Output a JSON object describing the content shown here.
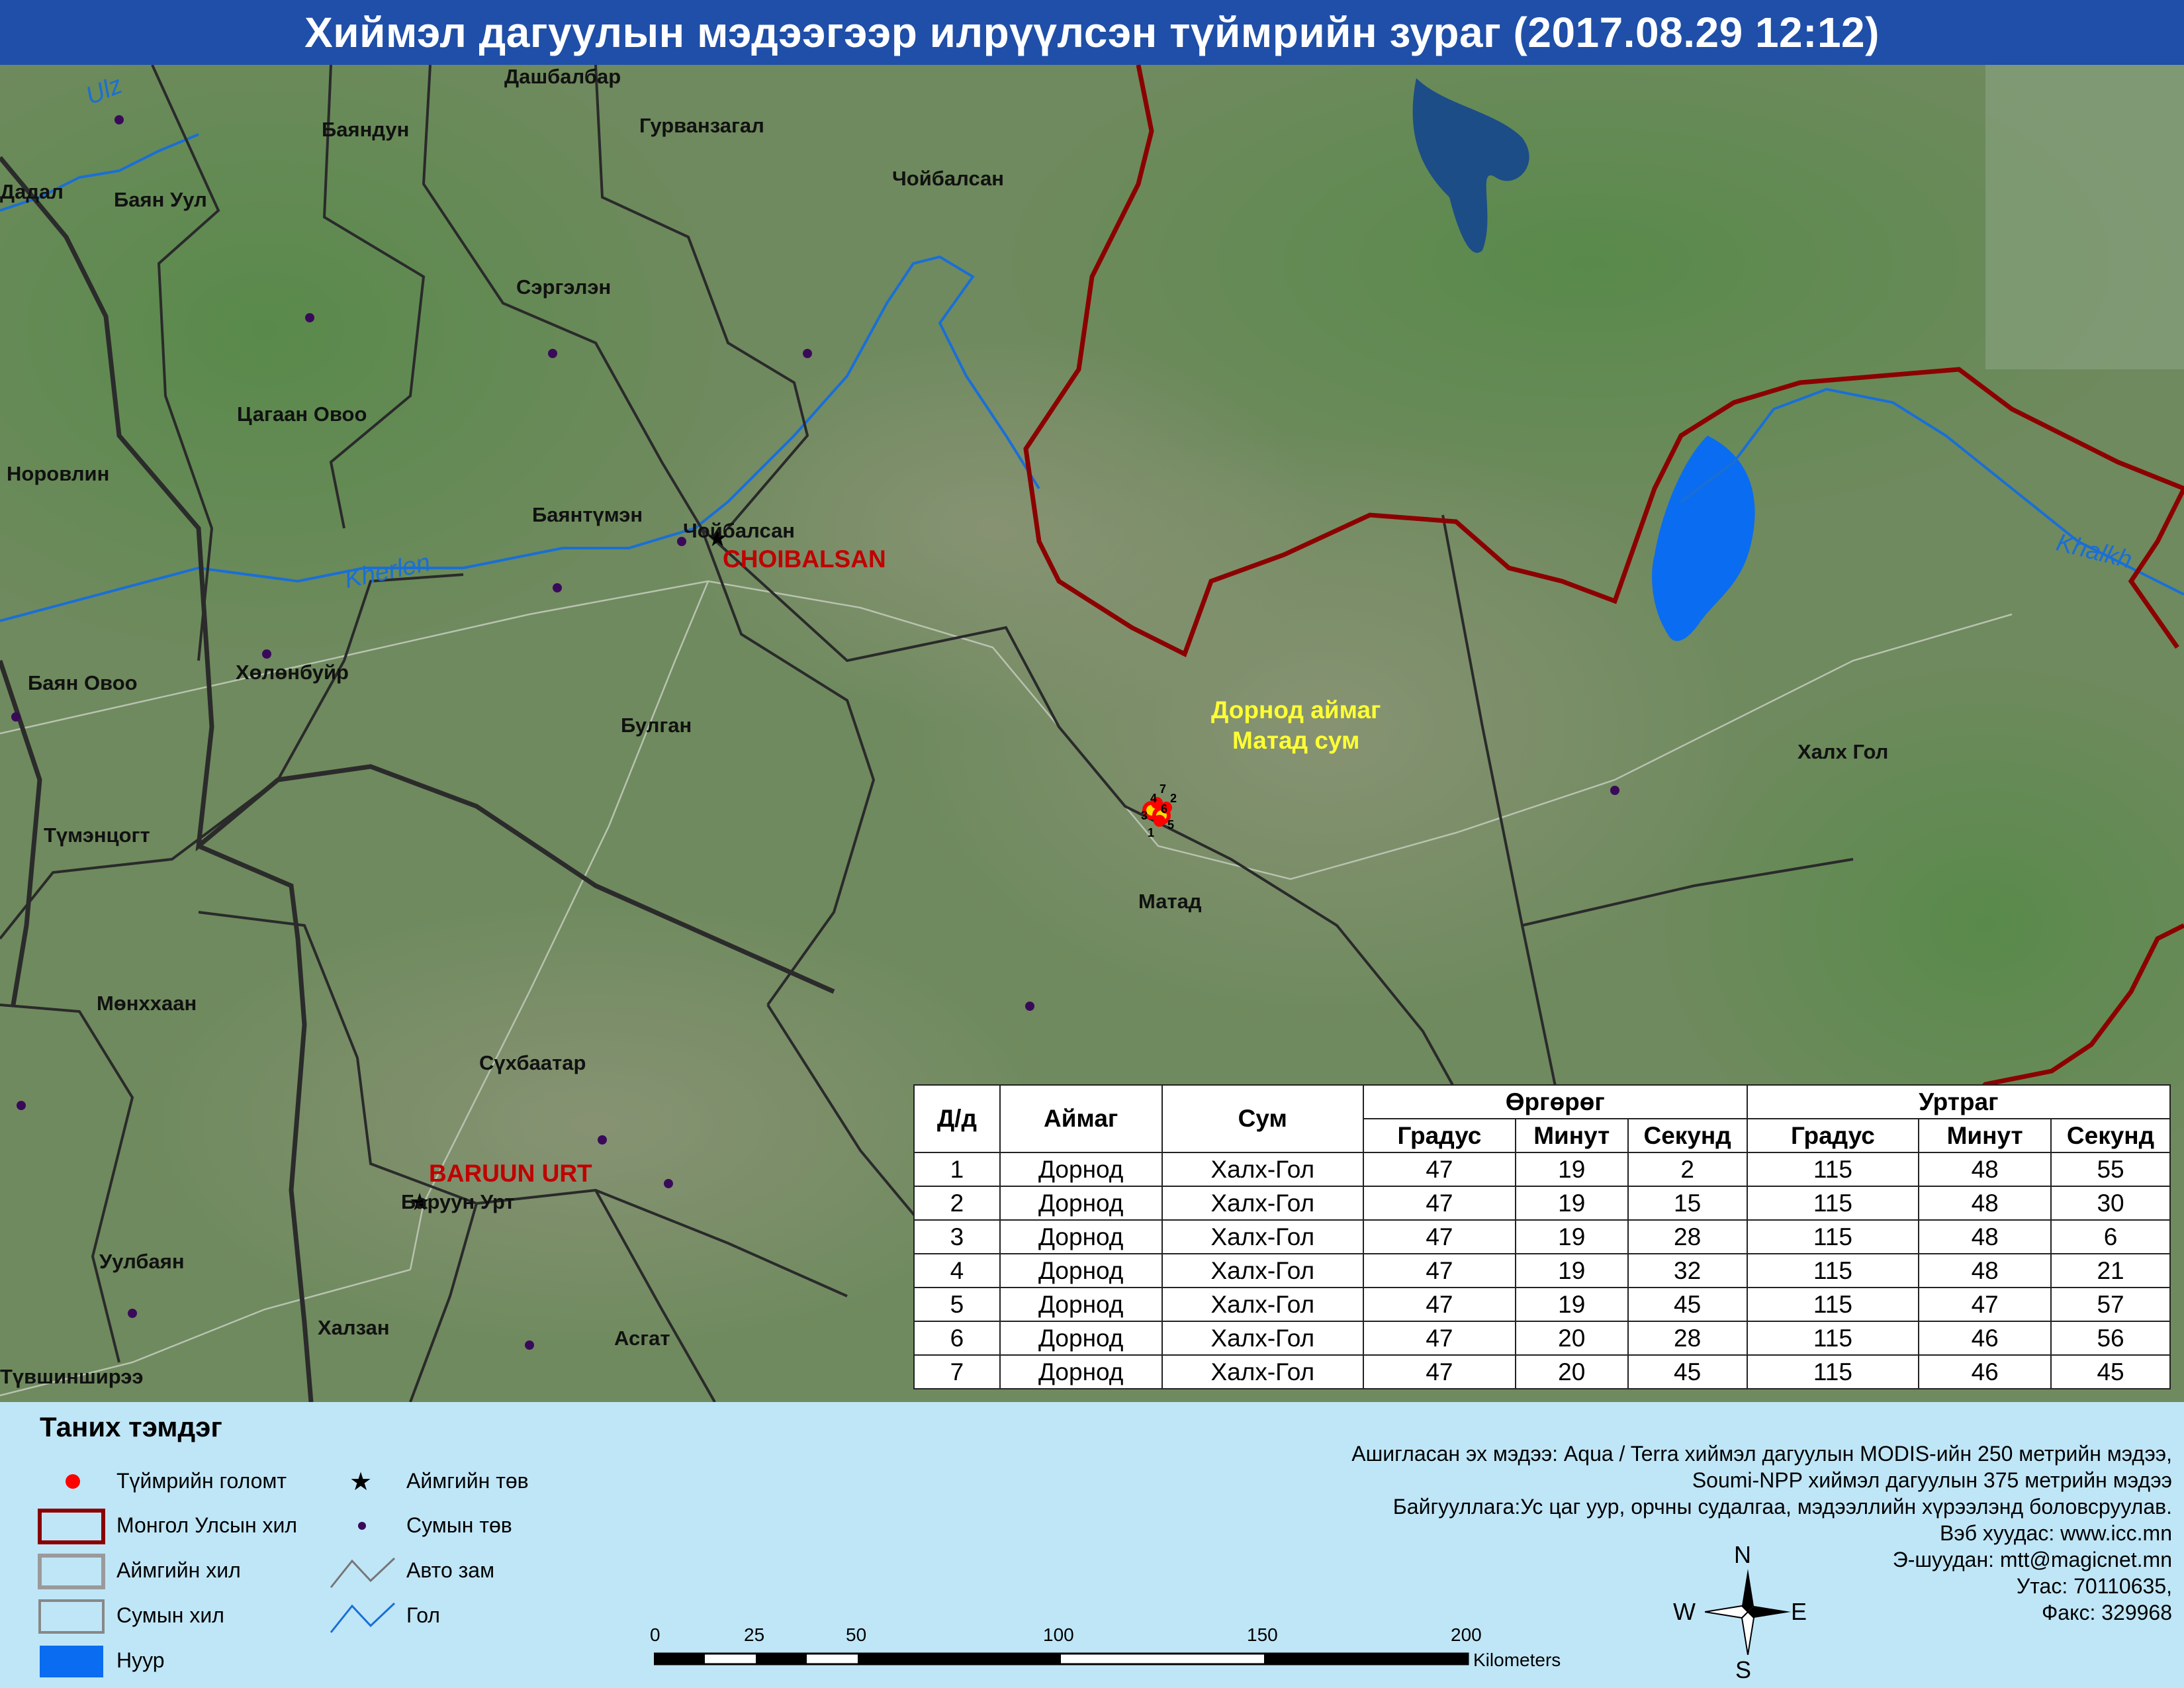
{
  "title": "Хиймэл дагуулын мэдээгээр илрүүлсэн түймрийн зураг  (2017.08.29 12:12)",
  "map": {
    "places": [
      {
        "id": "dashbalbar",
        "label": "Дашбалбар"
      },
      {
        "id": "bayandun",
        "label": "Баяндун"
      },
      {
        "id": "gurvanzagal",
        "label": "Гурванзагал"
      },
      {
        "id": "choibalsan-sum",
        "label": "Чойбалсан"
      },
      {
        "id": "dadal",
        "label": "Дадал"
      },
      {
        "id": "bayan-uul",
        "label": "Баян Уул"
      },
      {
        "id": "sergelen",
        "label": "Сэргэлэн"
      },
      {
        "id": "tsagaan-ovoo",
        "label": "Цагаан Овоо"
      },
      {
        "id": "norovlin",
        "label": "Норовлин"
      },
      {
        "id": "bayantumen",
        "label": "Баянтүмэн"
      },
      {
        "id": "choibalsan-city",
        "label": "Чойбалсан"
      },
      {
        "id": "bayan-ovoo",
        "label": "Баян Овоо"
      },
      {
        "id": "kholonbuir",
        "label": "Хөлөнбуйр"
      },
      {
        "id": "bulgan",
        "label": "Булган"
      },
      {
        "id": "tumentsogt",
        "label": "Түмэнцогт"
      },
      {
        "id": "khalkh-gol",
        "label": "Халх Гол"
      },
      {
        "id": "matad",
        "label": "Матад"
      },
      {
        "id": "munkhkhaan",
        "label": "Мөнххаан"
      },
      {
        "id": "sukhbaatar",
        "label": "Сүхбаатар"
      },
      {
        "id": "baruun-urt-sum",
        "label": "Баруун Урт"
      },
      {
        "id": "uulbayan",
        "label": "Уулбаян"
      },
      {
        "id": "khalzan",
        "label": "Халзан"
      },
      {
        "id": "asgat",
        "label": "Асгат"
      },
      {
        "id": "tuvshinshiree",
        "label": "Түвшинширээ"
      }
    ],
    "aimag_centers": [
      {
        "id": "choibalsan",
        "label": "CHOIBALSAN"
      },
      {
        "id": "baruun-urt",
        "label": "BARUUN URT"
      }
    ],
    "rivers": [
      {
        "id": "ulz",
        "label": "Ulz"
      },
      {
        "id": "kherlen",
        "label": "Kherlen"
      },
      {
        "id": "khalkh",
        "label": "Khalkh"
      }
    ],
    "highlight": {
      "line1": "Дорнод аймаг",
      "line2": "Матад сум"
    },
    "fire_point_labels": [
      "1",
      "2",
      "3",
      "4",
      "5",
      "6",
      "7"
    ]
  },
  "table": {
    "headers": {
      "no": "Д/д",
      "aimag": "Аймаг",
      "sum": "Сум",
      "lat": "Өргөрөг",
      "lon": "Уртраг",
      "deg": "Градус",
      "min": "Минут",
      "sec": "Секунд"
    },
    "rows": [
      {
        "no": "1",
        "aimag": "Дорнод",
        "sum": "Халх-Гол",
        "lat_deg": "47",
        "lat_min": "19",
        "lat_sec": "2",
        "lon_deg": "115",
        "lon_min": "48",
        "lon_sec": "55"
      },
      {
        "no": "2",
        "aimag": "Дорнод",
        "sum": "Халх-Гол",
        "lat_deg": "47",
        "lat_min": "19",
        "lat_sec": "15",
        "lon_deg": "115",
        "lon_min": "48",
        "lon_sec": "30"
      },
      {
        "no": "3",
        "aimag": "Дорнод",
        "sum": "Халх-Гол",
        "lat_deg": "47",
        "lat_min": "19",
        "lat_sec": "28",
        "lon_deg": "115",
        "lon_min": "48",
        "lon_sec": "6"
      },
      {
        "no": "4",
        "aimag": "Дорнод",
        "sum": "Халх-Гол",
        "lat_deg": "47",
        "lat_min": "19",
        "lat_sec": "32",
        "lon_deg": "115",
        "lon_min": "48",
        "lon_sec": "21"
      },
      {
        "no": "5",
        "aimag": "Дорнод",
        "sum": "Халх-Гол",
        "lat_deg": "47",
        "lat_min": "19",
        "lat_sec": "45",
        "lon_deg": "115",
        "lon_min": "47",
        "lon_sec": "57"
      },
      {
        "no": "6",
        "aimag": "Дорнод",
        "sum": "Халх-Гол",
        "lat_deg": "47",
        "lat_min": "20",
        "lat_sec": "28",
        "lon_deg": "115",
        "lon_min": "46",
        "lon_sec": "56"
      },
      {
        "no": "7",
        "aimag": "Дорнод",
        "sum": "Халх-Гол",
        "lat_deg": "47",
        "lat_min": "20",
        "lat_sec": "45",
        "lon_deg": "115",
        "lon_min": "46",
        "lon_sec": "45"
      }
    ]
  },
  "legend": {
    "title": "Таних тэмдэг",
    "items": {
      "fire": "Түймрийн голомт",
      "aimag_center": "Аймгийн төв",
      "state_border": "Монгол Улсын хил",
      "sum_center": "Сумын төв",
      "aimag_border": "Аймгийн хил",
      "road": "Авто зам",
      "sum_border": "Сумын хил",
      "river": "Гол",
      "lake": "Нуур"
    },
    "colors": {
      "fire": "#ff0000",
      "state_border": "#8b0000",
      "lake": "#0a6cf0",
      "river": "#1a6fd6",
      "sum_center": "#3a0a5a"
    }
  },
  "scale": {
    "ticks": [
      "0",
      "25",
      "50",
      "100",
      "150",
      "200"
    ],
    "unit": "Kilometers"
  },
  "compass": {
    "n": "N",
    "s": "S",
    "e": "E",
    "w": "W"
  },
  "source": {
    "line1": "Ашигласан эх мэдээ: Aqua / Terra хиймэл дагуулын MODIS-ийн 250 метрийн мэдээ,",
    "line2": "Soumi-NPP хиймэл дагуулын 375 метрийн мэдээ",
    "line3": "Байгууллага:Ус цаг уур, орчны судалгаа, мэдээллийн хүрээлэнд боловсруулав.",
    "line4": "Вэб хуудас: www.icc.mn",
    "line5": "Э-шуудан: mtt@magicnet.mn",
    "line6": "Утас: 70110635,",
    "line7": "Факс: 329968"
  }
}
